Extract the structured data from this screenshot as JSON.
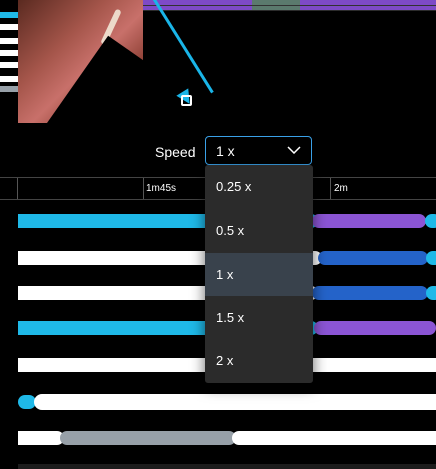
{
  "speed": {
    "label": "Speed",
    "selected": "1 x",
    "options": [
      "0.25 x",
      "0.5 x",
      "1 x",
      "1.5 x",
      "2 x"
    ]
  },
  "timeline": {
    "tick_labels": [
      "1m45s",
      "2m"
    ]
  },
  "colors": {
    "accent": "#1ab5e8",
    "purple": "#8b55d4",
    "blue": "#2463c9",
    "gray": "#97a0a8",
    "menu_bg": "#2b2b2b",
    "menu_selected": "#39424c"
  },
  "icons": {
    "cursor": "mouse-cursor-icon",
    "dropdown": "chevron-down-icon"
  }
}
